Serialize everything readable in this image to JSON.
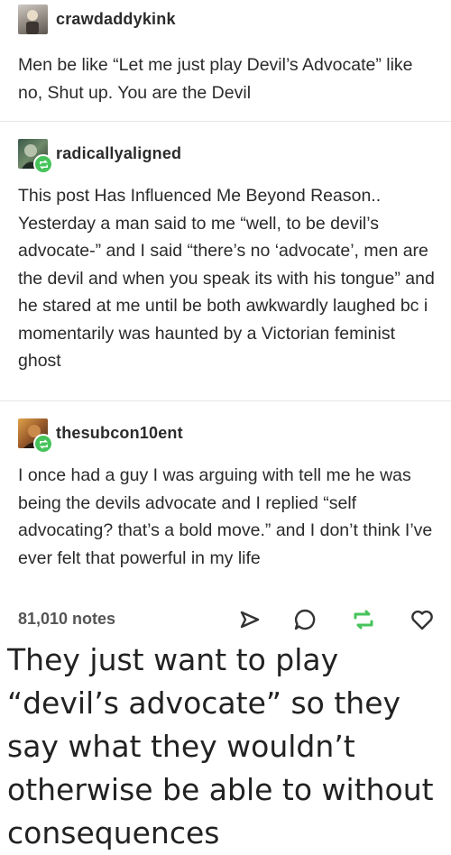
{
  "posts": [
    {
      "username": "crawdaddykink",
      "text": "Men be like “Let me just play Devil’s Advocate” like no, Shut up. You are the Devil"
    },
    {
      "username": "radicallyaligned",
      "text": "This post Has Influenced Me Beyond Reason.. Yesterday a man said to me “well, to be devil’s advocate-” and I said “there’s no ‘advocate’, men are the devil and when you speak its with his tongue” and he stared at me until be both awkwardly laughed bc i momentarily was haunted by a Victorian feminist ghost"
    },
    {
      "username": "thesubcon10ent",
      "text": "I once had a guy I was arguing with tell me he was being the devils advocate and I replied “self advocating? that’s a bold move.” and I don’t think I’ve ever felt that powerful in my life"
    }
  ],
  "footer": {
    "notes": "81,010 notes"
  },
  "caption": "They just want to play “devil’s advocate” so they say what they wouldn’t otherwise be able to without consequences",
  "colors": {
    "reblog_green": "#46c35b",
    "text": "#2a2a2a",
    "separator": "#e6e6e6"
  },
  "icons": [
    "share-icon",
    "reply-icon",
    "reblog-icon",
    "like-icon"
  ]
}
